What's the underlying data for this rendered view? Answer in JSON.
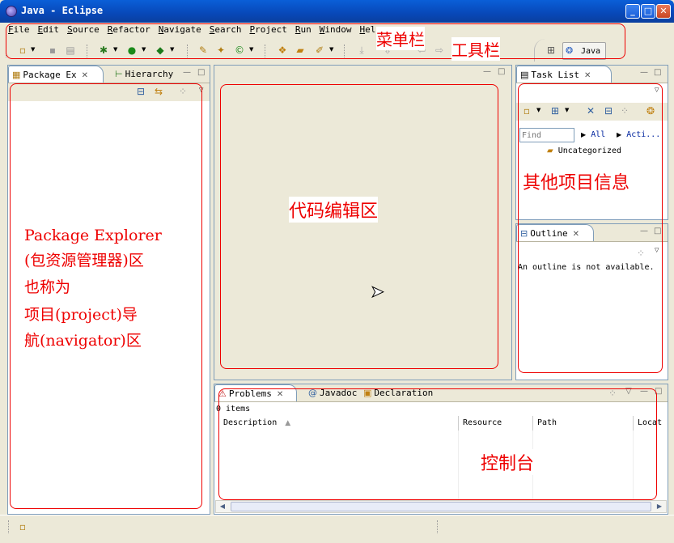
{
  "window": {
    "title": "Java - Eclipse",
    "min": "_",
    "max": "□",
    "close": "✕"
  },
  "menu": [
    "File",
    "Edit",
    "Source",
    "Refactor",
    "Navigate",
    "Search",
    "Project",
    "Run",
    "Window",
    "Help"
  ],
  "perspective": {
    "label": "Java"
  },
  "left_panel": {
    "tab_active": "Package Ex",
    "tab_other": "Hierarchy"
  },
  "task_list": {
    "tab": "Task List",
    "find_placeholder": "Find",
    "filter_all": "All",
    "filter_active": "Acti...",
    "category": "Uncategorized"
  },
  "outline": {
    "tab": "Outline",
    "message": "An outline is not available."
  },
  "bottom_panel": {
    "tabs": [
      "Problems",
      "Javadoc",
      "Declaration"
    ],
    "count": "0 items",
    "columns": [
      "Description",
      "Resource",
      "Path",
      "Locat"
    ]
  },
  "annotations": {
    "menubar": "菜单栏",
    "toolbar": "工具栏",
    "editor": "代码编辑区",
    "others": "其他项目信息",
    "console": "控制台",
    "package_explorer": [
      "Package Explorer",
      "(包资源管理器)区",
      "也称为",
      "项目(project)导",
      "航(navigator)区"
    ]
  },
  "icons": {
    "new": "new-file-icon",
    "save": "save-icon",
    "print": "print-icon",
    "debug": "debug-icon",
    "run": "run-icon",
    "external-tools": "external-tools-icon"
  },
  "colors": {
    "titlebar": "#0848b8",
    "panel_border": "#7f9db9",
    "annotation": "#e00000"
  }
}
